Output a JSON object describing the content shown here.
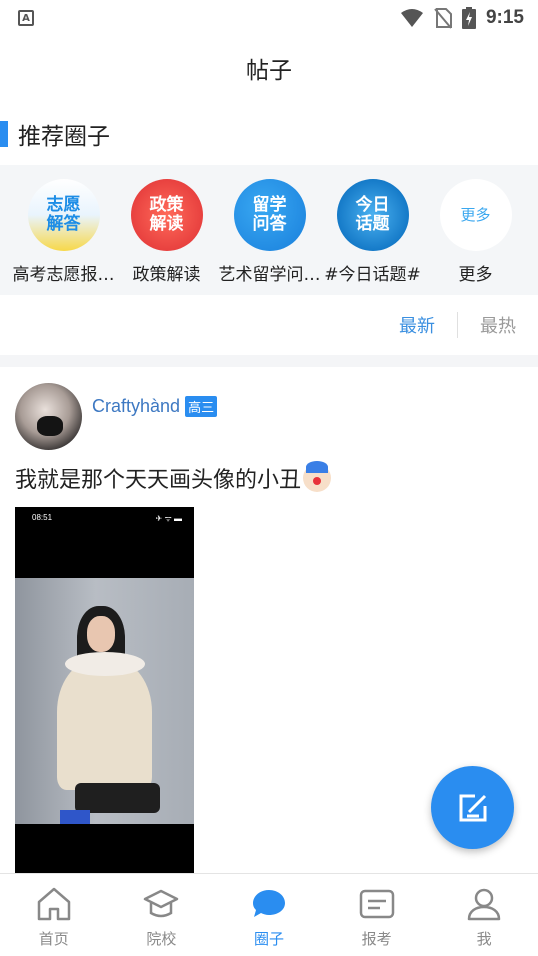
{
  "status_bar": {
    "left_icon": "A",
    "time": "9:15",
    "icons": [
      "wifi-icon",
      "no-sim-icon",
      "battery-charging-icon"
    ]
  },
  "header": {
    "title": "帖子"
  },
  "recommended": {
    "title": "推荐圈子",
    "items": [
      {
        "label": "高考志愿报…",
        "icon_text": "志愿\n解答",
        "icon": "circle-volunteer"
      },
      {
        "label": "政策解读",
        "icon_text": "政策\n解读",
        "icon": "circle-policy"
      },
      {
        "label": "艺术留学问…",
        "icon_text": "留学\n问答",
        "icon": "circle-study-abroad"
      },
      {
        "label": "#今日话题#",
        "icon_text": "今日\n话题",
        "icon": "circle-topic"
      },
      {
        "label": "更多",
        "icon_text": "更多",
        "icon": "circle-more"
      }
    ]
  },
  "sort": {
    "latest": "最新",
    "hottest": "最热",
    "active": "latest"
  },
  "post": {
    "username": "Craftyhànd",
    "grade": "高三",
    "text": "我就是那个天天画头像的小丑",
    "emoji": "clown-emoji",
    "image": {
      "status_time": "08:51",
      "status_right": "✈ ᯤ ▬"
    }
  },
  "fab": {
    "icon": "edit-icon"
  },
  "bottom_nav": {
    "items": [
      {
        "label": "首页",
        "icon": "home-icon"
      },
      {
        "label": "院校",
        "icon": "school-icon"
      },
      {
        "label": "圈子",
        "icon": "chat-bubble-icon"
      },
      {
        "label": "报考",
        "icon": "application-icon"
      },
      {
        "label": "我",
        "icon": "user-icon"
      }
    ],
    "active_index": 2
  },
  "colors": {
    "accent": "#2a8df0",
    "username": "#3d78c2"
  }
}
